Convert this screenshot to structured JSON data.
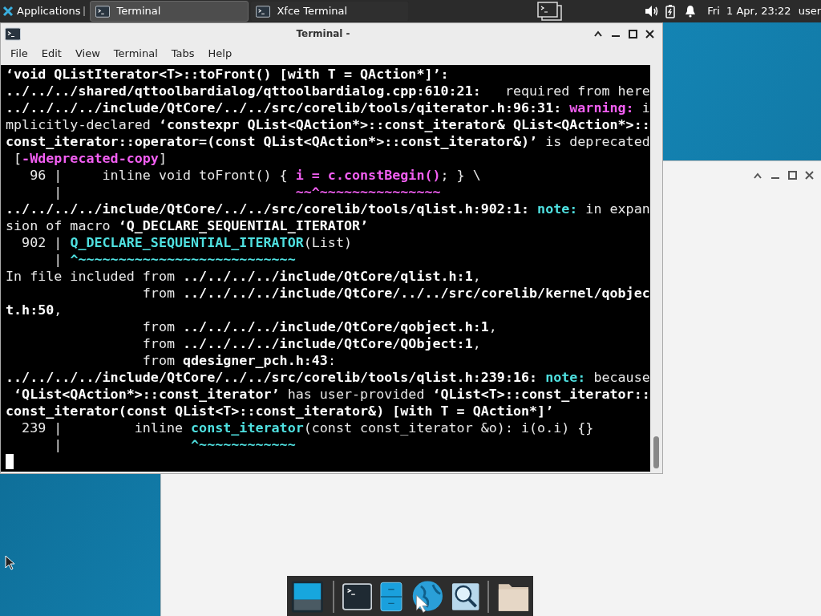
{
  "panel": {
    "app_menu": "Applications",
    "tasks": [
      {
        "label": "Terminal",
        "selected": true
      },
      {
        "label": "Xfce Terminal",
        "selected": false
      }
    ],
    "clock": "Fri  1 Apr, 23:22",
    "user": "user"
  },
  "terminal": {
    "title": "Terminal -",
    "menu": [
      "File",
      "Edit",
      "View",
      "Terminal",
      "Tabs",
      "Help"
    ],
    "lines": [
      [
        {
          "kind": "path",
          "text": "‘void QListIterator<T>::toFront() [with T = QAction*]’:"
        }
      ],
      [
        {
          "kind": "path",
          "text": "../../../shared/qttoolbardialog/qttoolbardialog.cpp:610:21:"
        },
        {
          "kind": "message",
          "text": "   required from here"
        }
      ],
      [
        {
          "kind": "path",
          "text": "../../../../include/QtCore/../../src/corelib/tools/qiterator.h:96:31: "
        },
        {
          "kind": "warning",
          "text": "warning:"
        },
        {
          "kind": "message",
          "text": " i"
        }
      ],
      [
        {
          "kind": "message",
          "text": "mplicitly-declared "
        },
        {
          "kind": "path",
          "text": "‘constexpr QList<QAction*>::const_iterator& QList<QAction*>::"
        }
      ],
      [
        {
          "kind": "path",
          "text": "const_iterator::operator=(const QList<QAction*>::const_iterator&)’"
        },
        {
          "kind": "message",
          "text": " is deprecated"
        }
      ],
      [
        {
          "kind": "message",
          "text": " ["
        },
        {
          "kind": "warning",
          "text": "-Wdeprecated-copy"
        },
        {
          "kind": "message",
          "text": "]"
        }
      ],
      [
        {
          "kind": "message",
          "text": "   96 |     inline void toFront() { "
        },
        {
          "kind": "warning",
          "text": "i = c.constBegin()"
        },
        {
          "kind": "message",
          "text": "; } \\"
        }
      ],
      [
        {
          "kind": "message",
          "text": "      |                             "
        },
        {
          "kind": "warning",
          "text": "~~^~~~~~~~~~~~~~~~"
        }
      ],
      [
        {
          "kind": "path",
          "text": "../../../../include/QtCore/../../src/corelib/tools/qlist.h:902:1: "
        },
        {
          "kind": "note",
          "text": "note:"
        },
        {
          "kind": "message",
          "text": " in expan"
        }
      ],
      [
        {
          "kind": "message",
          "text": "sion of macro "
        },
        {
          "kind": "path",
          "text": "‘Q_DECLARE_SEQUENTIAL_ITERATOR’"
        }
      ],
      [
        {
          "kind": "message",
          "text": "  902 | "
        },
        {
          "kind": "note",
          "text": "Q_DECLARE_SEQUENTIAL_ITERATOR"
        },
        {
          "kind": "message",
          "text": "(List)"
        }
      ],
      [
        {
          "kind": "message",
          "text": "      | "
        },
        {
          "kind": "note",
          "text": "^~~~~~~~~~~~~~~~~~~~~~~~~~~~"
        }
      ],
      [
        {
          "kind": "message",
          "text": "In file included from "
        },
        {
          "kind": "path",
          "text": "../../../../include/QtCore/qlist.h:1"
        },
        {
          "kind": "message",
          "text": ","
        }
      ],
      [
        {
          "kind": "message",
          "text": "                 from "
        },
        {
          "kind": "path",
          "text": "../../../../include/QtCore/../../src/corelib/kernel/qobjec"
        }
      ],
      [
        {
          "kind": "path",
          "text": "t.h:50"
        },
        {
          "kind": "message",
          "text": ","
        }
      ],
      [
        {
          "kind": "message",
          "text": "                 from "
        },
        {
          "kind": "path",
          "text": "../../../../include/QtCore/qobject.h:1"
        },
        {
          "kind": "message",
          "text": ","
        }
      ],
      [
        {
          "kind": "message",
          "text": "                 from "
        },
        {
          "kind": "path",
          "text": "../../../../include/QtCore/QObject:1"
        },
        {
          "kind": "message",
          "text": ","
        }
      ],
      [
        {
          "kind": "message",
          "text": "                 from "
        },
        {
          "kind": "path",
          "text": "qdesigner_pch.h:43"
        },
        {
          "kind": "message",
          "text": ":"
        }
      ],
      [
        {
          "kind": "path",
          "text": "../../../../include/QtCore/../../src/corelib/tools/qlist.h:239:16: "
        },
        {
          "kind": "note",
          "text": "note:"
        },
        {
          "kind": "message",
          "text": " because"
        }
      ],
      [
        {
          "kind": "path",
          "text": " ‘QList<QAction*>::const_iterator’"
        },
        {
          "kind": "message",
          "text": " has user-provided "
        },
        {
          "kind": "path",
          "text": "‘QList<T>::const_iterator::"
        }
      ],
      [
        {
          "kind": "path",
          "text": "const_iterator(const QList<T>::const_iterator&) [with T = QAction*]’"
        }
      ],
      [
        {
          "kind": "message",
          "text": "  239 |         inline "
        },
        {
          "kind": "note",
          "text": "const_iterator"
        },
        {
          "kind": "message",
          "text": "(const const_iterator &o): i(o.i) {}"
        }
      ],
      [
        {
          "kind": "message",
          "text": "      |                "
        },
        {
          "kind": "note",
          "text": "^~~~~~~~~~~~~"
        }
      ]
    ]
  }
}
